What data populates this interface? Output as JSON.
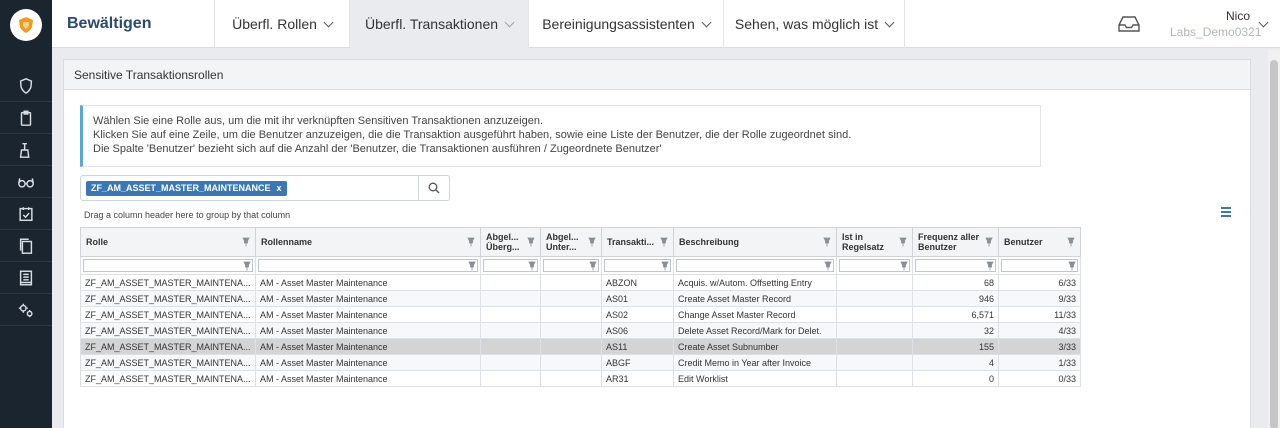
{
  "app": {
    "title": "Bewältigen"
  },
  "nav": [
    {
      "label": "Überfl. Rollen"
    },
    {
      "label": "Überfl. Transaktionen"
    },
    {
      "label": "Bereinigungsassistenten"
    },
    {
      "label": "Sehen, was möglich ist"
    }
  ],
  "user": {
    "name": "Nico",
    "tenant": "Labs_Demo0321"
  },
  "rail_icons": [
    "shield-icon",
    "clipboard-icon",
    "broom-icon",
    "glasses-icon",
    "calendar-check-icon",
    "documents-icon",
    "report-icon",
    "settings-cogs-icon"
  ],
  "panel": {
    "title": "Sensitive Transaktionsrollen"
  },
  "info": {
    "line1": "Wählen Sie eine Rolle aus, um die mit ihr verknüpften Sensitiven Transaktionen anzuzeigen.",
    "line2": "Klicken Sie auf eine Zeile, um die Benutzer anzuzeigen, die die Transaktion ausgeführt haben, sowie eine Liste der Benutzer, die der Rolle zugeordnet sind.",
    "line3": "Die Spalte 'Benutzer' bezieht sich auf die Anzahl der 'Benutzer, die Transaktionen ausführen / Zugeordnete Benutzer'"
  },
  "search": {
    "chip": "ZF_AM_ASSET_MASTER_MAINTENANCE",
    "chip_remove": "x"
  },
  "grid": {
    "group_hint": "Drag a column header here to group by that column",
    "columns": [
      "Rolle",
      "Rollenname",
      "Abgel... Überg...",
      "Abgel... Unter...",
      "Transakti...",
      "Beschreibung",
      "Ist in Regelsatz",
      "Frequenz aller Benutzer",
      "Benutzer"
    ],
    "rows": [
      [
        "ZF_AM_ASSET_MASTER_MAINTENA...",
        "AM - Asset Master Maintenance",
        "",
        "",
        "ABZON",
        "Acquis. w/Autom. Offsetting Entry",
        "",
        "68",
        "6/33"
      ],
      [
        "ZF_AM_ASSET_MASTER_MAINTENA...",
        "AM - Asset Master Maintenance",
        "",
        "",
        "AS01",
        "Create Asset Master Record",
        "",
        "946",
        "9/33"
      ],
      [
        "ZF_AM_ASSET_MASTER_MAINTENA...",
        "AM - Asset Master Maintenance",
        "",
        "",
        "AS02",
        "Change Asset Master Record",
        "",
        "6,571",
        "11/33"
      ],
      [
        "ZF_AM_ASSET_MASTER_MAINTENA...",
        "AM - Asset Master Maintenance",
        "",
        "",
        "AS06",
        "Delete Asset Record/Mark for Delet.",
        "",
        "32",
        "4/33"
      ],
      [
        "ZF_AM_ASSET_MASTER_MAINTENA...",
        "AM - Asset Master Maintenance",
        "",
        "",
        "AS11",
        "Create Asset Subnumber",
        "",
        "155",
        "3/33"
      ],
      [
        "ZF_AM_ASSET_MASTER_MAINTENA...",
        "AM - Asset Master Maintenance",
        "",
        "",
        "ABGF",
        "Credit Memo in Year after Invoice",
        "",
        "4",
        "1/33"
      ],
      [
        "ZF_AM_ASSET_MASTER_MAINTENA...",
        "AM - Asset Master Maintenance",
        "",
        "",
        "AR31",
        "Edit Worklist",
        "",
        "0",
        "0/33"
      ]
    ],
    "selected_row": 4
  },
  "colors": {
    "brand": "#2b4a70",
    "accent": "#3a78b5",
    "rail": "#1b2530",
    "logo": "#f39a1e"
  }
}
